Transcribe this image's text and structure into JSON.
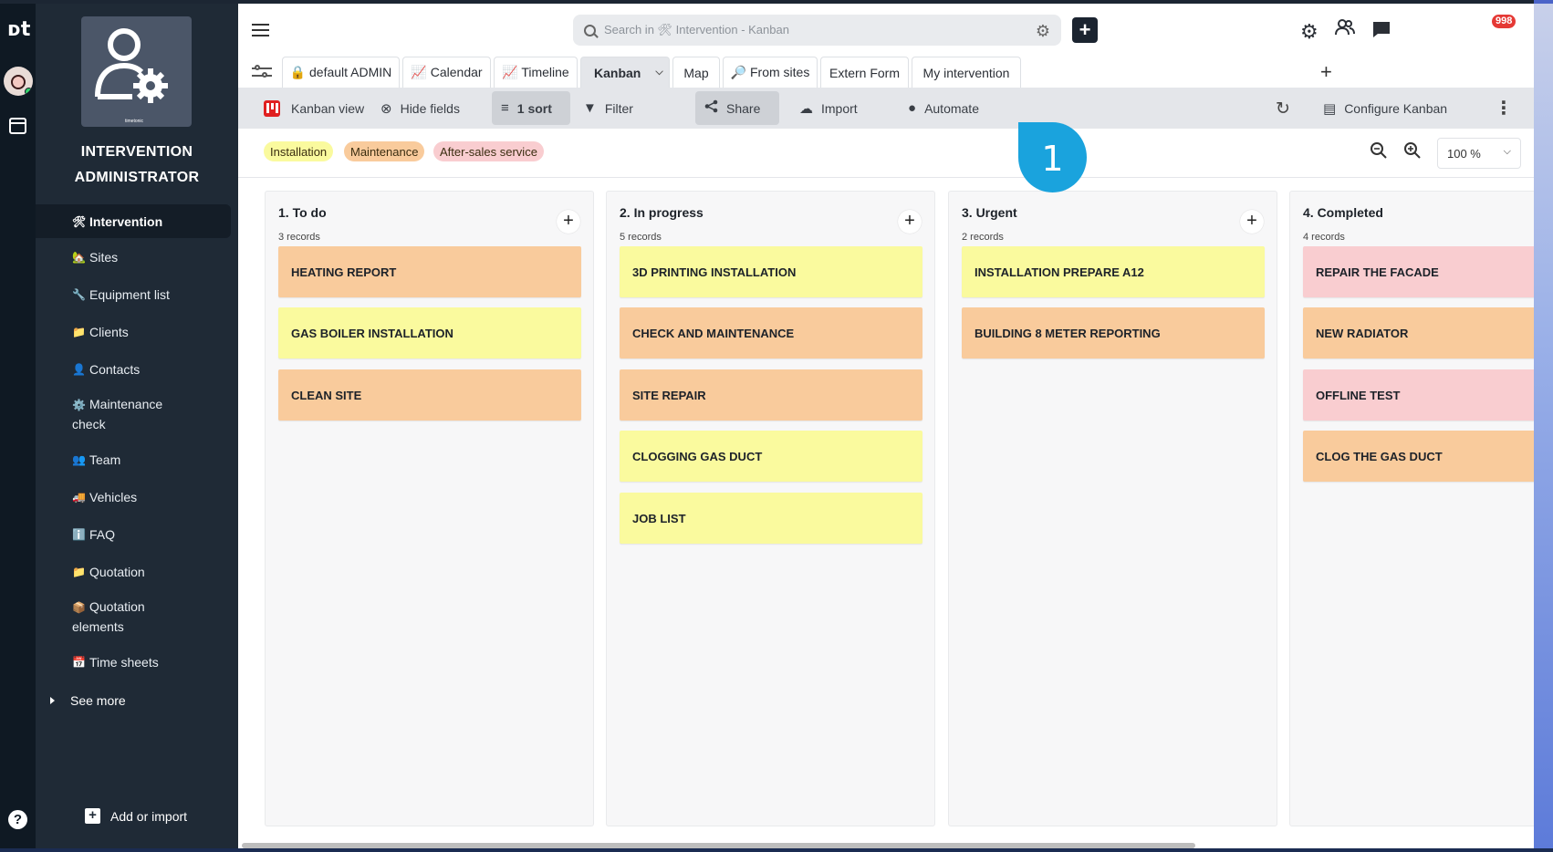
{
  "rail": {
    "logo": "ᴅt",
    "help": "?"
  },
  "sidebar": {
    "app_title_line1": "INTERVENTION",
    "app_title_line2": "ADMINISTRATOR",
    "app_icon_caption": "timetonic",
    "items": [
      {
        "emoji": "🛠",
        "label": "Intervention",
        "active": true
      },
      {
        "emoji": "🏡",
        "label": "Sites"
      },
      {
        "emoji": "🔧",
        "label": "Equipment list"
      },
      {
        "emoji": "📁",
        "label": "Clients"
      },
      {
        "emoji": "👤",
        "label": "Contacts"
      },
      {
        "emoji": "⚙️",
        "label": "Maintenance check"
      },
      {
        "emoji": "👥",
        "label": "Team"
      },
      {
        "emoji": "🚚",
        "label": "Vehicles"
      },
      {
        "emoji": "ℹ️",
        "label": "FAQ"
      },
      {
        "emoji": "📁",
        "label": "Quotation"
      },
      {
        "emoji": "📦",
        "label": "Quotation elements"
      },
      {
        "emoji": "📅",
        "label": "Time sheets"
      }
    ],
    "see_more": "See more",
    "add_or_import": "Add or import"
  },
  "topbar": {
    "search_placeholder": "Search in 🛠 Intervention - Kanban",
    "notifications_count": "998"
  },
  "tabs": [
    {
      "label": "🔒 default ADMIN"
    },
    {
      "label": "📈 Calendar"
    },
    {
      "label": "📈 Timeline"
    },
    {
      "label": "Kanban",
      "active": true
    },
    {
      "label": "Map"
    },
    {
      "label": "🔎 From sites"
    },
    {
      "label": "Extern Form"
    },
    {
      "label": "My intervention"
    }
  ],
  "toolbar": {
    "kanban_view": "Kanban view",
    "hide_fields": "Hide fields",
    "sort": "1 sort",
    "filter": "Filter",
    "share": "Share",
    "import": "Import",
    "automate": "Automate",
    "configure": "Configure Kanban"
  },
  "chips": [
    {
      "label": "Installation",
      "color": "#fafa9e"
    },
    {
      "label": "Maintenance",
      "color": "#f9cb9c"
    },
    {
      "label": "After-sales service",
      "color": "#f9cdd0"
    }
  ],
  "zoom": "100 %",
  "callout": "1",
  "columns": [
    {
      "title": "1. To do",
      "count": "3 records",
      "cards": [
        {
          "label": "HEATING REPORT",
          "color": "#f9cb9c"
        },
        {
          "label": "GAS BOILER INSTALLATION",
          "color": "#fafa9e"
        },
        {
          "label": "CLEAN SITE",
          "color": "#f9cb9c"
        }
      ]
    },
    {
      "title": "2. In progress",
      "count": "5 records",
      "cards": [
        {
          "label": "3D PRINTING INSTALLATION",
          "color": "#fafa9e"
        },
        {
          "label": "CHECK AND MAINTENANCE",
          "color": "#f9cb9c"
        },
        {
          "label": "SITE REPAIR",
          "color": "#f9cb9c"
        },
        {
          "label": "CLOGGING GAS DUCT",
          "color": "#fafa9e"
        },
        {
          "label": "JOB LIST",
          "color": "#fafa9e"
        }
      ]
    },
    {
      "title": "3. Urgent",
      "count": "2 records",
      "cards": [
        {
          "label": "INSTALLATION PREPARE A12",
          "color": "#fafa9e"
        },
        {
          "label": "BUILDING 8 METER REPORTING",
          "color": "#f9cb9c"
        }
      ]
    },
    {
      "title": "4. Completed",
      "count": "4 records",
      "cards": [
        {
          "label": "REPAIR THE FACADE",
          "color": "#f9cdd0"
        },
        {
          "label": "NEW RADIATOR",
          "color": "#f9cb9c"
        },
        {
          "label": "OFFLINE TEST",
          "color": "#f9cdd0"
        },
        {
          "label": "CLOG THE GAS DUCT",
          "color": "#f9cb9c"
        }
      ]
    }
  ]
}
